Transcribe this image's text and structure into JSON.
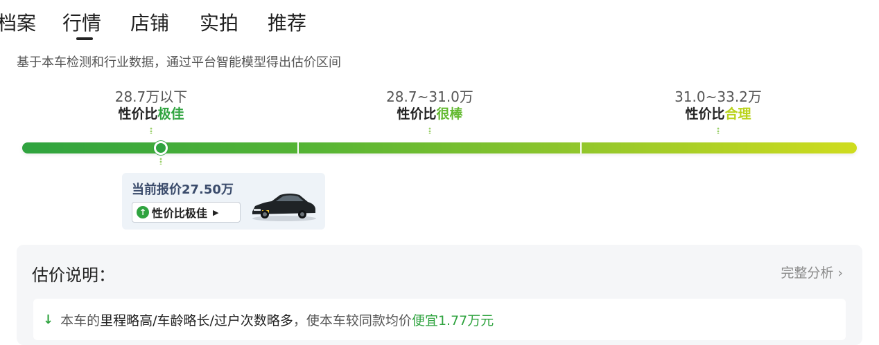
{
  "tabs": [
    "档案",
    "行情",
    "店铺",
    "实拍",
    "推荐"
  ],
  "active_tab": "行情",
  "intro_text": "基于本车检测和行业数据，通过平台智能模型得出估价区间",
  "ranges": [
    {
      "price": "28.7万以下",
      "rating_prefix": "性价比",
      "rating": "极佳",
      "color": "#2fa33f"
    },
    {
      "price": "28.7~31.0万",
      "rating_prefix": "性价比",
      "rating": "很棒",
      "color": "#62b92f"
    },
    {
      "price": "31.0~33.2万",
      "rating_prefix": "性价比",
      "rating": "合理",
      "color": "#b9d31a"
    }
  ],
  "current_price": {
    "label": "当前报价27.50万",
    "badge_text": "性价比极佳",
    "badge_icon": "up-arrow-icon",
    "car_image": "black-sedan-image"
  },
  "explanation": {
    "title": "估价说明：",
    "link_label": "完整分析",
    "reason_icon": "down-arrow-icon",
    "reason_prefix": "本车的",
    "reason_highlight": "里程略高/车龄略长/过户次数略多",
    "reason_middle": "，使本车较同款均价",
    "reason_value": "便宜1.77万元"
  },
  "colors": {
    "accent_green": "#2fa33f",
    "mid_green": "#62b92f",
    "yellow_green": "#b9d31a"
  }
}
